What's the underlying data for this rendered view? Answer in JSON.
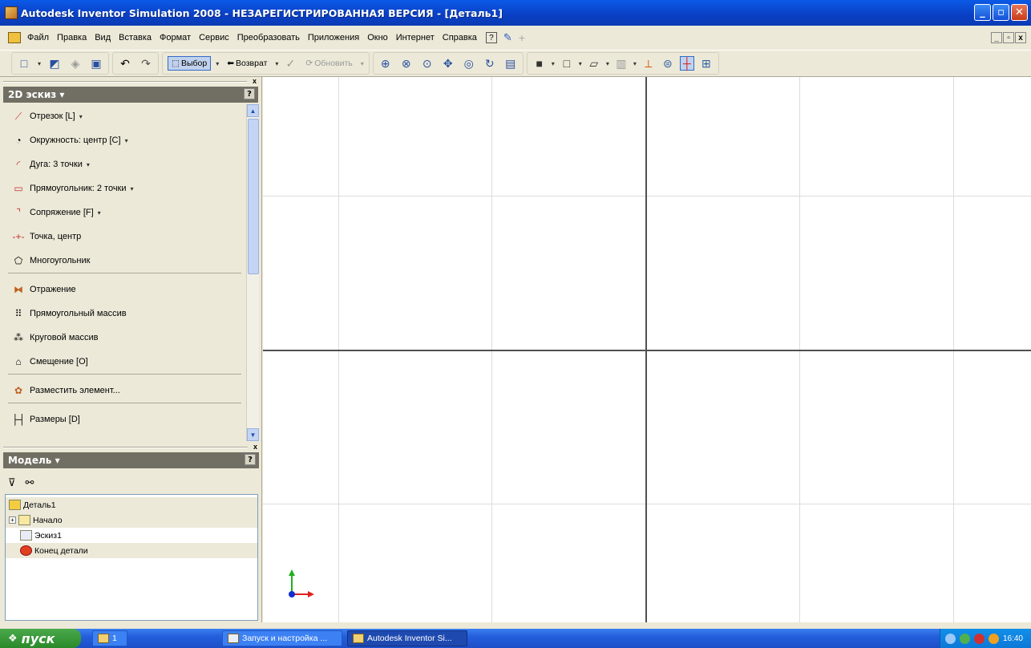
{
  "window": {
    "title": "Autodesk Inventor Simulation 2008 - НЕЗАРЕГИСТРИРОВАННАЯ ВЕРСИЯ - [Деталь1]",
    "minimize": "_",
    "restore": "▫",
    "close": "✕"
  },
  "menu": {
    "items": [
      "Файл",
      "Правка",
      "Вид",
      "Вставка",
      "Формат",
      "Сервис",
      "Преобразовать",
      "Приложения",
      "Окно",
      "Интернет",
      "Справка"
    ],
    "mdi": [
      "_",
      "▫",
      "x"
    ]
  },
  "toolbar": {
    "select_label": "Выбор",
    "back_label": "Возврат",
    "update_label": "Обновить"
  },
  "sketch_panel": {
    "title": "2D эскиз ▾",
    "help": "?",
    "close": "x",
    "items": [
      {
        "label": "Отрезок  [L]",
        "icon": "line-icon",
        "dropdown": true
      },
      {
        "label": "Окружность: центр  [C]",
        "icon": "circle-icon",
        "dropdown": true
      },
      {
        "label": "Дуга: 3 точки",
        "icon": "arc-icon",
        "dropdown": true
      },
      {
        "label": "Прямоугольник: 2 точки",
        "icon": "rectangle-icon",
        "dropdown": true
      },
      {
        "label": "Сопряжение  [F]",
        "icon": "fillet-icon",
        "dropdown": true
      },
      {
        "label": "Точка, центр",
        "icon": "point-icon",
        "dropdown": false
      },
      {
        "label": "Многоугольник",
        "icon": "polygon-icon",
        "dropdown": false
      },
      {
        "label": "Отражение",
        "icon": "mirror-icon",
        "dropdown": false
      },
      {
        "label": "Прямоугольный массив",
        "icon": "rect-array-icon",
        "dropdown": false
      },
      {
        "label": "Круговой массив",
        "icon": "circ-array-icon",
        "dropdown": false
      },
      {
        "label": "Смещение  [O]",
        "icon": "offset-icon",
        "dropdown": false
      },
      {
        "label": "Разместить элемент...",
        "icon": "place-feature-icon",
        "dropdown": false
      },
      {
        "label": "Размеры  [D]",
        "icon": "dimension-icon",
        "dropdown": false
      }
    ]
  },
  "model_panel": {
    "title": "Модель ▾",
    "help": "?",
    "close": "x",
    "tree": [
      {
        "label": "Деталь1",
        "icon": "part-icon"
      },
      {
        "label": "Начало",
        "icon": "folder-icon",
        "expander": "+"
      },
      {
        "label": "Эскиз1",
        "icon": "sketch-icon"
      },
      {
        "label": "Конец детали",
        "icon": "end-of-part-icon"
      }
    ]
  },
  "taskbar": {
    "start_label": "пуск",
    "tasks": [
      {
        "label": "1"
      },
      {
        "label": "Запуск и настройка ..."
      },
      {
        "label": "Autodesk Inventor Si..."
      }
    ],
    "clock": "16:40"
  },
  "colors": {
    "titlebar": "#0a5ae6",
    "panel_head": "#716f64",
    "axis_x": "#e02020",
    "axis_y": "#20b020",
    "axis_origin": "#1030d0"
  }
}
